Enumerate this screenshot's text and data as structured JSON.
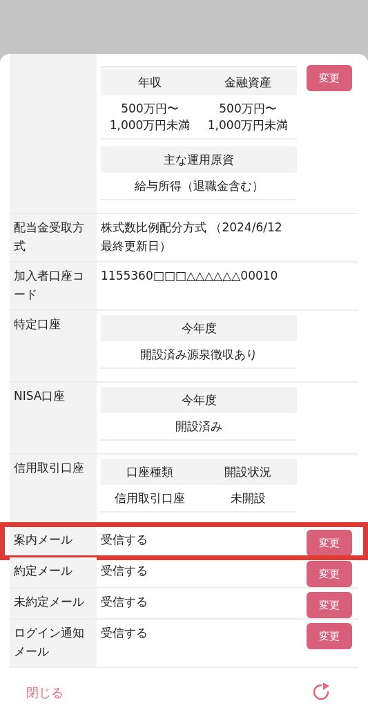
{
  "rows": [
    {
      "label": "",
      "kind": "tables",
      "highlighted": false,
      "button": "変更",
      "tables": [
        {
          "headers": [
            "年収",
            "金融資産"
          ],
          "cells": [
            "500万円〜\n1,000万円未満",
            "500万円〜\n1,000万円未満"
          ]
        },
        {
          "headers": [
            "主な運用原資"
          ],
          "cells": [
            "給与所得（退職金含む）"
          ]
        }
      ]
    },
    {
      "label": "配当金受取方式",
      "kind": "text",
      "highlighted": false,
      "value": "株式数比例配分方式 （2024/6/12 最終更新日）"
    },
    {
      "label": "加入者口座コード",
      "kind": "text",
      "highlighted": false,
      "value": "1155360□□□△△△△△△00010"
    },
    {
      "label": "特定口座",
      "kind": "tables",
      "highlighted": false,
      "tables": [
        {
          "headers": [
            "今年度"
          ],
          "cells": [
            "開設済み源泉徴収あり"
          ]
        }
      ]
    },
    {
      "label": "NISA口座",
      "kind": "tables",
      "highlighted": false,
      "tables": [
        {
          "headers": [
            "今年度"
          ],
          "cells": [
            "開設済み"
          ]
        }
      ]
    },
    {
      "label": "信用取引口座",
      "kind": "tables",
      "highlighted": false,
      "tables": [
        {
          "headers": [
            "口座種類",
            "開設状況"
          ],
          "cells": [
            "信用取引口座",
            "未開設"
          ]
        }
      ]
    },
    {
      "label": "案内メール",
      "kind": "text",
      "highlighted": true,
      "value": "受信する",
      "button": "変更"
    },
    {
      "label": "約定メール",
      "kind": "text",
      "highlighted": false,
      "value": "受信する",
      "button": "変更"
    },
    {
      "label": "未約定メール",
      "kind": "text",
      "highlighted": false,
      "value": "受信する",
      "button": "変更"
    },
    {
      "label": "ログイン通知メール",
      "kind": "text",
      "highlighted": false,
      "value": "受信する",
      "button": "変更"
    }
  ],
  "footer": {
    "close": "閉じる"
  }
}
